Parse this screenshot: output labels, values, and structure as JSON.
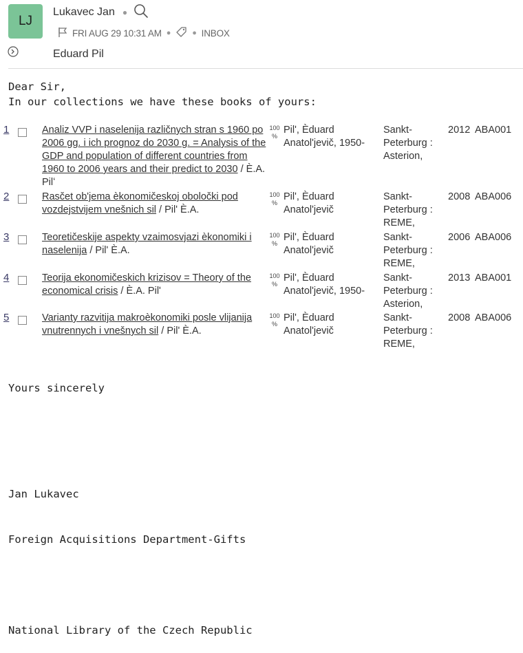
{
  "header": {
    "avatar_initials": "LJ",
    "avatar_color": "#7bc497",
    "sender_name": "Lukavec Jan",
    "date": "FRI AUG 29 10:31 AM",
    "folder": "INBOX",
    "recipient": "Eduard Pil"
  },
  "body": {
    "salutation": "Dear Sir,",
    "intro": "In our collections we have these books of yours:"
  },
  "books": [
    {
      "num": "1",
      "title": "Analiz VVP i naselenija različnych stran s 1960 po 2006 gg. i ich prognoz do 2030 g. = Analysis of the GDP and population of different countries from 1960 to 2006 years and their predict to 2030",
      "resp": " / È.A. Pilʻ",
      "pct": "100 %",
      "author": "Pilʹ, Èduard Anatolʹjevič, 1950-",
      "place": "Sankt-Peterburg : Asterion,",
      "year": "2012",
      "code": "ABA001"
    },
    {
      "num": "2",
      "title": "Rasčet obʹjema èkonomičeskoj oboločki pod vozdejstvijem vnešnich sil",
      "resp": " / Pilʹ È.A.",
      "pct": "100 %",
      "author": "Pilʹ, Èduard Anatolʹjevič",
      "place": "Sankt-Peterburg : REME,",
      "year": "2008",
      "code": "ABA006"
    },
    {
      "num": "3",
      "title": "Teoretičeskije aspekty vzaimosvjazi èkonomiki i naselenija",
      "resp": " / Pilʹ È.A.",
      "pct": "100 %",
      "author": "Pilʹ, Èduard Anatolʹjevič",
      "place": "Sankt-Peterburg : REME,",
      "year": "2006",
      "code": "ABA006"
    },
    {
      "num": "4",
      "title": "Teorija ekonomičeskich krizisov = Theory of the economical crisis",
      "resp": " / È.A. Pilʹ",
      "pct": "100 %",
      "author": "Pilʹ, Èduard Anatolʹjevič, 1950-",
      "place": "Sankt-Peterburg : Asterion,",
      "year": "2013",
      "code": "ABA001"
    },
    {
      "num": "5",
      "title": "Varianty razvitija makroèkonomiki posle vlijanija vnutrennych i vnešnych sil",
      "resp": " / Pilʹ È.A.",
      "pct": "100 %",
      "author": "Pilʹ, Èduard Anatolʹjevič",
      "place": "Sankt-Peterburg : REME,",
      "year": "2008",
      "code": "ABA006"
    }
  ],
  "closing": {
    "sign_off": "Yours sincerely",
    "name": "Jan Lukavec",
    "department": "Foreign Acquisitions Department-Gifts",
    "institution": "National Library of the Czech Republic"
  }
}
